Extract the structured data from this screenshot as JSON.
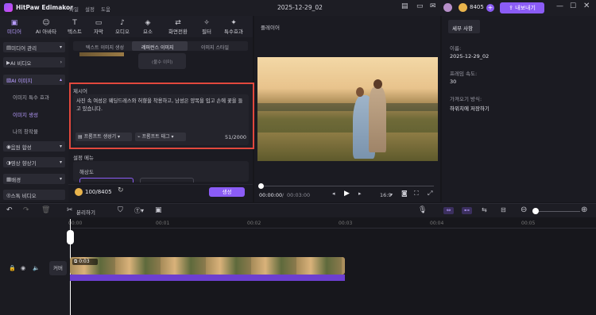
{
  "app": {
    "name": "HitPaw Edimakor",
    "menu": [
      "파일",
      "설정",
      "도움"
    ],
    "title": "2025-12-29_02",
    "credits": "8405",
    "upgrade_label": "내보내기"
  },
  "toolbar": {
    "tabs": [
      "미디어",
      "AI 아바타",
      "텍스트",
      "자막",
      "오디오",
      "요소",
      "화면전환",
      "필터",
      "특수효과"
    ]
  },
  "leftnav": {
    "items": [
      {
        "label": "미디어 관리"
      },
      {
        "label": "AI 비디오"
      },
      {
        "label": "AI 이미지"
      },
      {
        "label": "이미지 특수 효과"
      },
      {
        "label": "이미지 생성"
      },
      {
        "label": "나의 창작물"
      },
      {
        "label": "음원 합성"
      },
      {
        "label": "영상 향상기"
      },
      {
        "label": "배경"
      },
      {
        "label": "스톡 비디오"
      }
    ]
  },
  "panel": {
    "tabs": [
      "텍스트 이미지 생성",
      "레퍼런스 이미지",
      "이미지 스타일"
    ],
    "preview_tag": "(불수 이미)",
    "prompt_label": "제시어",
    "prompt_text": "사진 속 여성은 웨딩드레스와 허향을 착용하고, 남성은 양복을 입고 손에 꽃을 들고 있습니다.",
    "prompt_btn1": "프롬프트 생성기",
    "prompt_btn2": "프롬프트 태그",
    "counter": "51/2000",
    "settings_label": "설정 메뉴",
    "resolution_label": "해상도",
    "cost": "100/8405",
    "generate_label": "생성"
  },
  "preview": {
    "title": "플레이어",
    "time_current": "00:00:00",
    "time_total": "00:03:00",
    "ratio": "16:9"
  },
  "right": {
    "tab": "세부 사항",
    "name_label": "이름:",
    "name_value": "2025-12-29_02",
    "fps_label": "프레임 속도:",
    "fps_value": "30",
    "import_label": "가져오기 방식:",
    "import_value": "하위치에 저장하기"
  },
  "tl": {
    "split_label": "분리하기",
    "ticks": [
      "00:00",
      "00:01",
      "00:02",
      "00:03",
      "00:04",
      "00:05"
    ],
    "clip_time": "0:03",
    "cover_label": "커버"
  },
  "colors": {
    "accent": "#8b5cf6",
    "highlight": "#e2483d"
  }
}
